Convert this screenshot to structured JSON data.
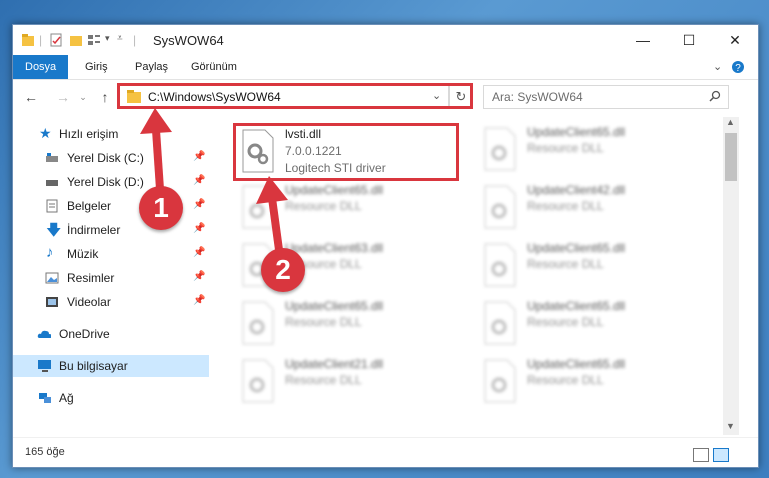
{
  "window": {
    "title": "SysWOW64"
  },
  "ribbon": {
    "tabs": [
      "Dosya",
      "Giriş",
      "Paylaş",
      "Görünüm"
    ]
  },
  "navbar": {
    "address": "C:\\Windows\\SysWOW64",
    "search_placeholder": "Ara: SysWOW64"
  },
  "sidebar": {
    "items": [
      {
        "label": "Hızlı erişim"
      },
      {
        "label": "Yerel Disk (C:)"
      },
      {
        "label": "Yerel Disk (D:)"
      },
      {
        "label": "Belgeler"
      },
      {
        "label": "İndirmeler"
      },
      {
        "label": "Müzik"
      },
      {
        "label": "Resimler"
      },
      {
        "label": "Videolar"
      },
      {
        "label": "OneDrive"
      },
      {
        "label": "Bu bilgisayar"
      },
      {
        "label": "Ağ"
      }
    ]
  },
  "files": [
    {
      "name": "lvsti.dll",
      "line2": "7.0.0.1221",
      "line3": "Logitech STI driver"
    },
    {
      "name": "UpdateClient65.dll",
      "line2": "Resource DLL"
    },
    {
      "name": "UpdateClient65.dll",
      "line2": "Resource DLL"
    },
    {
      "name": "UpdateClient42.dll",
      "line2": "Resource DLL"
    },
    {
      "name": "UpdateClient63.dll",
      "line2": "Resource DLL"
    },
    {
      "name": "UpdateClient65.dll",
      "line2": "Resource DLL"
    },
    {
      "name": "UpdateClient65.dll",
      "line2": "Resource DLL"
    },
    {
      "name": "UpdateClient65.dll",
      "line2": "Resource DLL"
    },
    {
      "name": "UpdateClient21.dll",
      "line2": "Resource DLL"
    },
    {
      "name": "UpdateClient65.dll",
      "line2": "Resource DLL"
    }
  ],
  "status": {
    "count": "165 öğe"
  },
  "annotations": {
    "badge1": "1",
    "badge2": "2"
  },
  "colors": {
    "accent": "#1979ca",
    "highlight": "#d9363e",
    "selection": "#cce8ff"
  }
}
